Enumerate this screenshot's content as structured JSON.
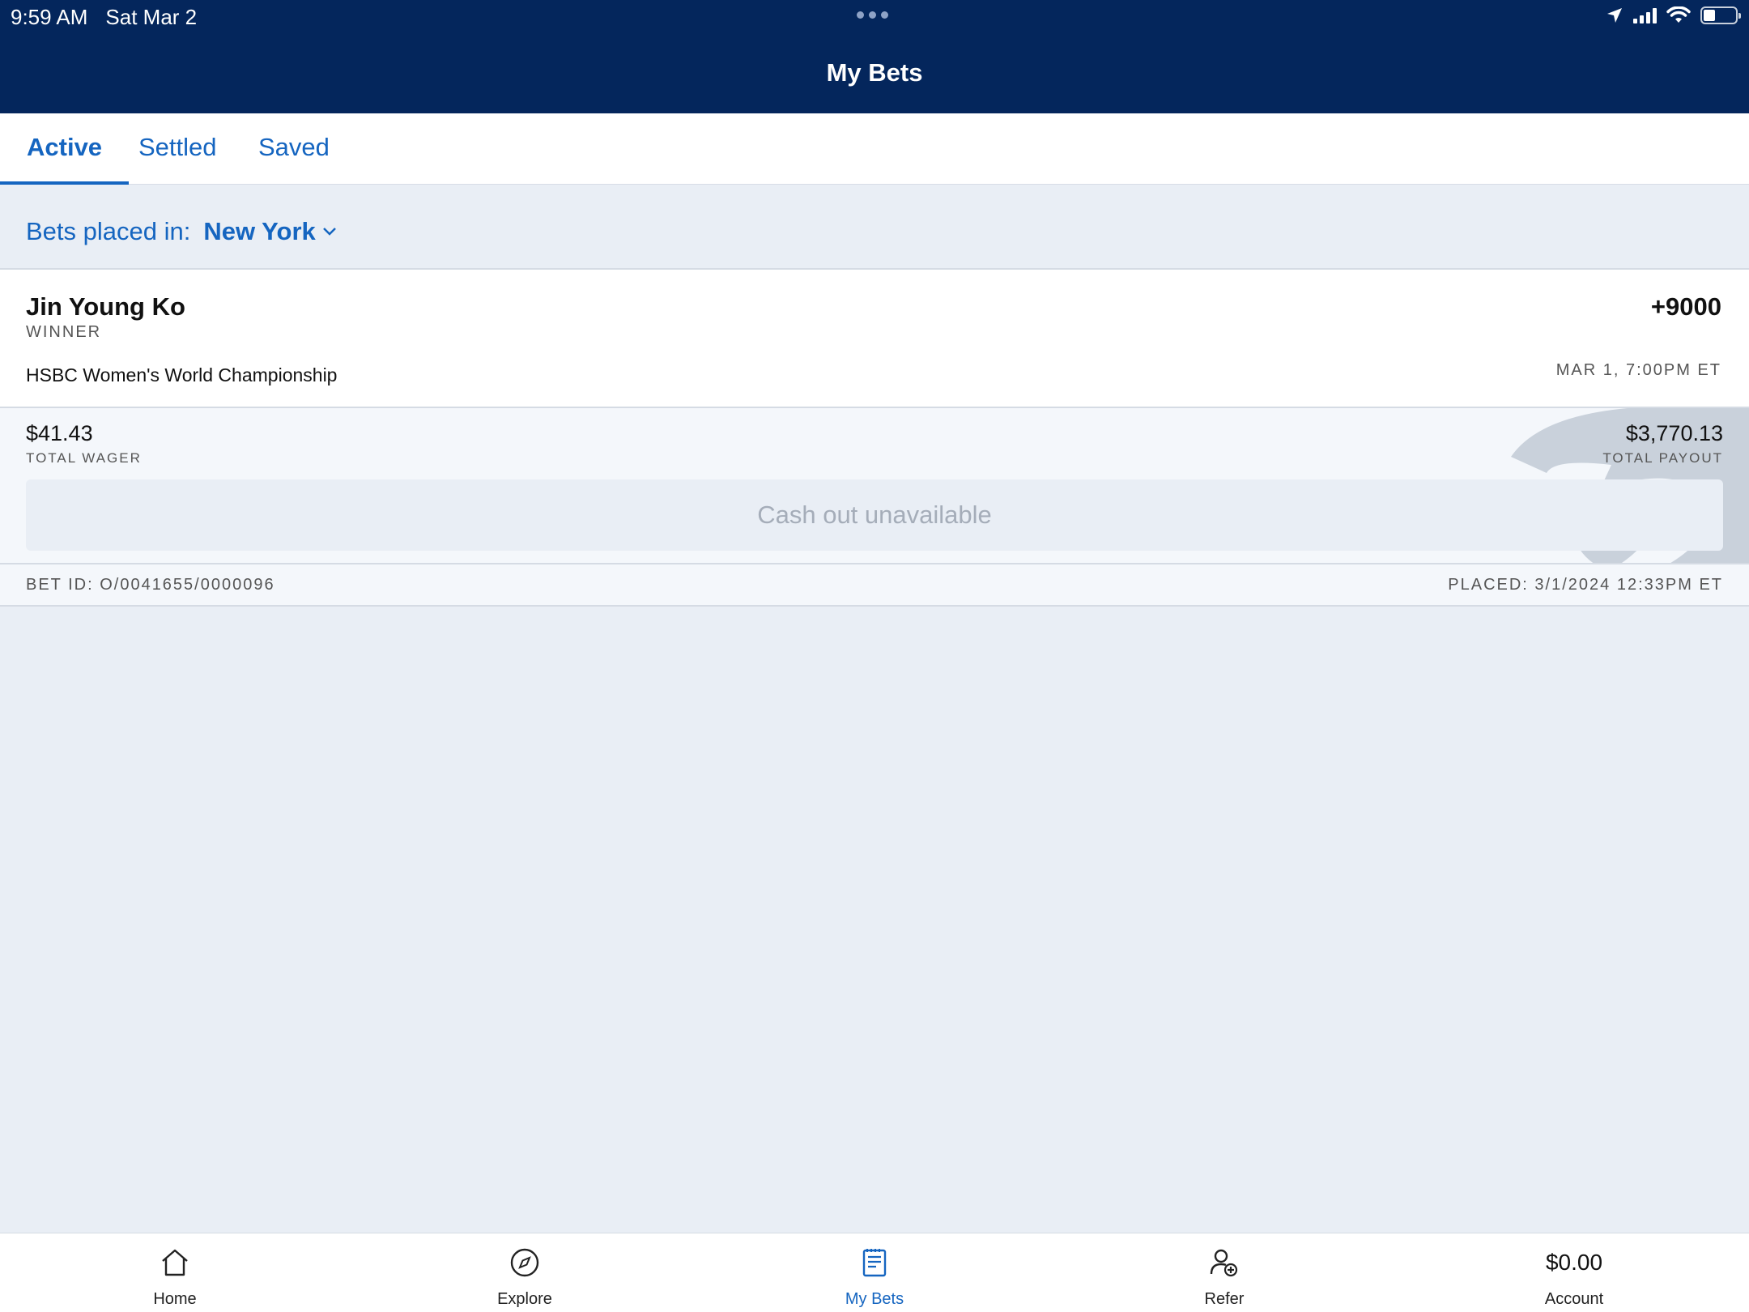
{
  "status_bar": {
    "time": "9:59 AM",
    "date": "Sat Mar 2"
  },
  "header": {
    "title": "My Bets"
  },
  "tabs": [
    {
      "label": "Active",
      "active": true
    },
    {
      "label": "Settled",
      "active": false
    },
    {
      "label": "Saved",
      "active": false
    }
  ],
  "filter": {
    "label": "Bets placed in:",
    "location": "New York"
  },
  "bet": {
    "selection": "Jin Young Ko",
    "odds": "+9000",
    "market": "WINNER",
    "event": "HSBC Women's World Championship",
    "event_time": "MAR 1, 7:00PM ET",
    "total_wager": "$41.43",
    "total_wager_label": "TOTAL WAGER",
    "total_payout": "$3,770.13",
    "total_payout_label": "TOTAL PAYOUT",
    "cashout_label": "Cash out unavailable",
    "bet_id": "BET ID: O/0041655/0000096",
    "placed": "PLACED: 3/1/2024 12:33PM ET"
  },
  "bottom_nav": {
    "items": [
      {
        "label": "Home",
        "icon": "home-icon"
      },
      {
        "label": "Explore",
        "icon": "compass-icon"
      },
      {
        "label": "My Bets",
        "icon": "bet-slip-icon",
        "active": true
      },
      {
        "label": "Refer",
        "icon": "add-user-icon"
      },
      {
        "label": "Account",
        "balance": "$0.00"
      }
    ]
  },
  "colors": {
    "header_bg": "#04265c",
    "accent": "#1565c0",
    "page_bg": "#e9eef5"
  }
}
